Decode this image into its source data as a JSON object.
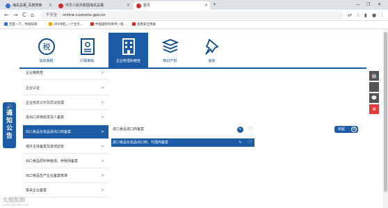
{
  "browser": {
    "tabs": [
      {
        "title": "海关总署_百度搜索",
        "color": "#3b6fd6"
      },
      {
        "title": "中华人民共和国海关总署",
        "color": "#c9302c"
      },
      {
        "title": "首页",
        "color": "#c9302c",
        "active": true
      }
    ],
    "new_tab": "+",
    "window_controls": [
      "—",
      "❐",
      "✕"
    ],
    "nav": {
      "back": "←",
      "forward": "→",
      "reload": "C",
      "home": "⌂"
    },
    "security_label": "不安全",
    "url": "online.customs.gov.cn",
    "bookmarks": [
      {
        "label": "百度一下，你就知道",
        "color": "#3b6fd6"
      },
      {
        "label": "360导航_一个主页...",
        "color": "#e8a317"
      },
      {
        "label": "中国国际贸易单一窗...",
        "color": "#c9302c"
      },
      {
        "label": "查看安全情报",
        "color": "#c9302c"
      }
    ]
  },
  "categories": [
    {
      "label": "加贸保税",
      "icon": "tax-seal-icon"
    },
    {
      "label": "行政审批",
      "icon": "certificate-icon"
    },
    {
      "label": "企业管理和稽查",
      "icon": "building-icon",
      "active": true
    },
    {
      "label": "知识产权",
      "icon": "books-icon"
    },
    {
      "label": "其他",
      "icon": "pushpin-icon"
    }
  ],
  "menu": [
    {
      "label": "企业稽核查"
    },
    {
      "label": "企业认证"
    },
    {
      "label": "企业信息公示及异议处理"
    },
    {
      "label": "进出口货物收发货人备案"
    },
    {
      "label": "出口食品化妆品进出口商备案",
      "active": true
    },
    {
      "label": "境外主体备案及其他监管"
    },
    {
      "label": "出口食品原料种植场、养殖场备案"
    },
    {
      "label": "出口食品生产企业备案核准"
    },
    {
      "label": "报关企业备案"
    }
  ],
  "submenu": [
    {
      "label": "进口食品进口商备案"
    },
    {
      "label": "进口食品化妆品出口商、代理商备案",
      "highlight": true
    }
  ],
  "collapse_label": "收起",
  "collapse_icon": "⊖",
  "notice": {
    "speaker": "🔊",
    "text": "通知公告"
  },
  "side_tools": [
    {
      "icon": "android-icon",
      "glyph": "🤖",
      "color": "#555555"
    },
    {
      "icon": "apple-icon",
      "glyph": "",
      "color": "#555555"
    },
    {
      "icon": "wechat-icon",
      "glyph": "💬",
      "color": "#555555"
    },
    {
      "icon": "close-icon",
      "glyph": "⊗",
      "color": "#e53935"
    }
  ],
  "watermark": {
    "main": "久恒知到",
    "sub": "jiuhengzhidao.com"
  },
  "colors": {
    "brand": "#1c5ba5"
  }
}
